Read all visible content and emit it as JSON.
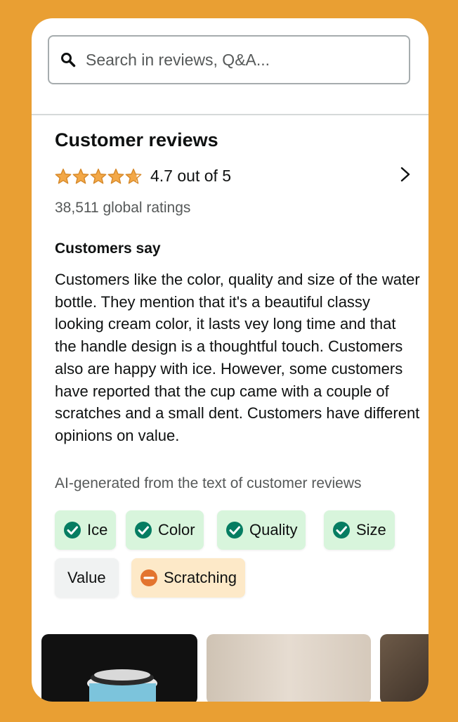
{
  "search": {
    "placeholder": "Search in reviews, Q&A..."
  },
  "reviews": {
    "title": "Customer reviews",
    "rating_value": 4.7,
    "rating_text": "4.7 out of 5",
    "global_ratings": "38,511 global ratings"
  },
  "customers_say": {
    "title": "Customers say",
    "summary": "Customers like the color, quality and size of the water bottle. They mention that it's a beautiful classy looking cream color, it lasts vey long time and that the handle design is a thoughtful touch. Customers also are happy with ice. However, some customers have reported that the cup came with a couple of scratches and a small dent. Customers have different opinions on value.",
    "ai_note": "AI-generated from the text of customer reviews"
  },
  "aspects": [
    {
      "label": "Ice",
      "sentiment": "positive",
      "icon": "check-circle-icon"
    },
    {
      "label": "Color",
      "sentiment": "positive",
      "icon": "check-circle-icon"
    },
    {
      "label": "Quality",
      "sentiment": "positive",
      "icon": "check-circle-icon"
    },
    {
      "label": "Size",
      "sentiment": "positive",
      "icon": "check-circle-icon"
    },
    {
      "label": "Value",
      "sentiment": "mixed",
      "icon": ""
    },
    {
      "label": "Scratching",
      "sentiment": "negative",
      "icon": "minus-circle-icon"
    }
  ],
  "colors": {
    "background": "#E99F33",
    "star": "#F3A847",
    "positive_chip": "#D8F5DC",
    "positive_icon": "#067D62",
    "negative_chip": "#FDE9C8",
    "negative_icon": "#E3742F",
    "neutral_chip": "#F0F2F2"
  }
}
